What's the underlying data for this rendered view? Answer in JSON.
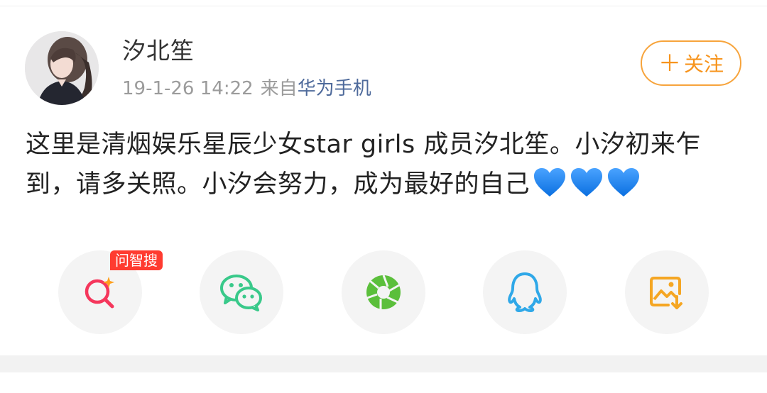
{
  "post": {
    "username": "汐北笙",
    "time": "19-1-26 14:22",
    "source_prefix": "来自",
    "source": "华为手机",
    "follow_label": "关注",
    "follow_plus": "＋",
    "text": "这里是清烟娱乐星辰少女star girls 成员汐北笙。小汐初来乍到，请多关照。小汐会努力，成为最好的自己",
    "emoji": [
      "blue-heart",
      "blue-heart",
      "blue-heart"
    ]
  },
  "share": {
    "badge": "问智搜",
    "items": [
      {
        "icon": "search-ai-icon",
        "color": "#f5375c"
      },
      {
        "icon": "wechat-icon",
        "color": "#39c98a"
      },
      {
        "icon": "moments-icon",
        "color": "#5bbf3b"
      },
      {
        "icon": "qq-icon",
        "color": "#2fa8e8"
      },
      {
        "icon": "save-image-icon",
        "color": "#f5a623"
      }
    ]
  },
  "colors": {
    "accent": "#f7941d",
    "link": "#4e6a9b",
    "meta": "#9b9b9b"
  }
}
